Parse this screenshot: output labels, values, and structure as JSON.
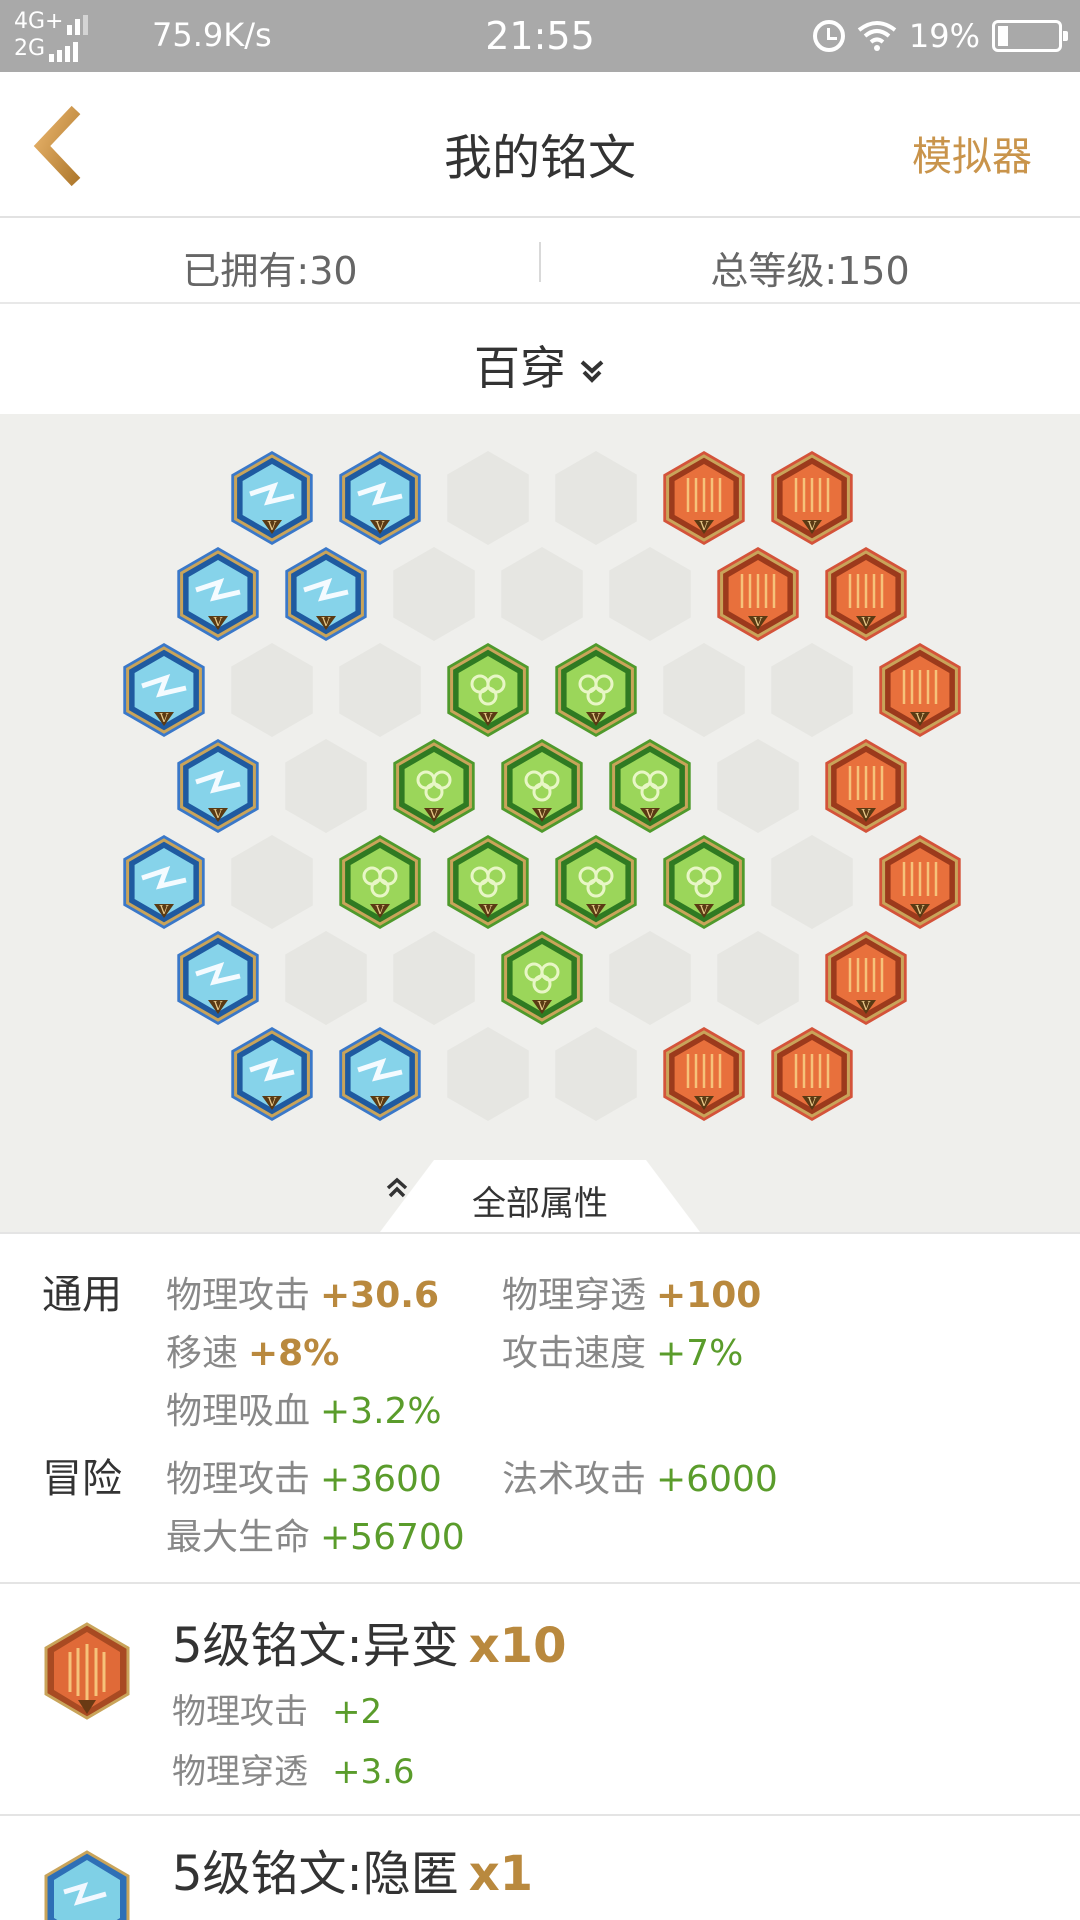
{
  "status_bar": {
    "net1": "4G+",
    "net2": "2G",
    "speed": "75.9K/s",
    "time": "21:55",
    "battery": "19%",
    "icons": [
      "signal-icon",
      "alarm-icon",
      "wifi-icon",
      "battery-icon"
    ]
  },
  "header": {
    "title": "我的铭文",
    "right_action": "模拟器",
    "back_icon": "chevron-left-icon"
  },
  "summary": {
    "owned": "已拥有:30",
    "total_level": "总等级:150"
  },
  "page_selector": {
    "label": "百穿",
    "icon": "double-chevron-down-icon"
  },
  "board": {
    "colors": {
      "blue": "#3a78c9",
      "red": "#d4533a",
      "green": "#4f9a2c",
      "empty": "#e6e6e2",
      "background": "#efefec"
    },
    "level_mark": "V",
    "slots": {
      "blue": 10,
      "green": 10,
      "red": 10
    }
  },
  "all_attributes_tab": {
    "label": "全部属性",
    "icon": "double-chevron-up-icon"
  },
  "attributes": {
    "general": {
      "label": "通用",
      "items": [
        {
          "name": "物理攻击",
          "value": "+30.6",
          "style": "gold"
        },
        {
          "name": "物理穿透",
          "value": "+100",
          "style": "gold"
        },
        {
          "name": "移速",
          "value": "+8%",
          "style": "gold"
        },
        {
          "name": "攻击速度",
          "value": "+7%",
          "style": "green"
        },
        {
          "name": "物理吸血",
          "value": "+3.2%",
          "style": "green"
        }
      ]
    },
    "adventure": {
      "label": "冒险",
      "items": [
        {
          "name": "物理攻击",
          "value": "+3600",
          "style": "green"
        },
        {
          "name": "法术攻击",
          "value": "+6000",
          "style": "green"
        },
        {
          "name": "最大生命",
          "value": "+56700",
          "style": "green"
        }
      ]
    }
  },
  "inscriptions": [
    {
      "name": "5级铭文:异变",
      "count": "x10",
      "color": "red",
      "stats": [
        {
          "name": "物理攻击",
          "value": "+2"
        },
        {
          "name": "物理穿透",
          "value": "+3.6"
        }
      ]
    },
    {
      "name": "5级铭文:隐匿",
      "count": "x1",
      "color": "blue",
      "stats": []
    }
  ]
}
